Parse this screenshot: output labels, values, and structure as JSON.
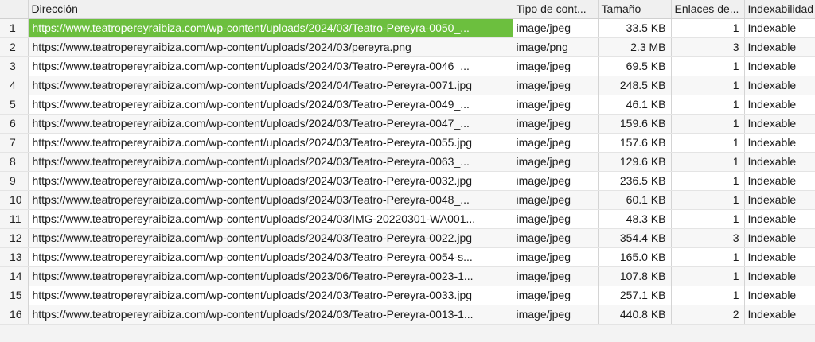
{
  "table": {
    "columns": [
      "",
      "Dirección",
      "Tipo de cont...",
      "Tamaño",
      "Enlaces de...",
      "Indexabilidad"
    ],
    "rows": [
      {
        "n": "1",
        "address": "https://www.teatropereyraibiza.com/wp-content/uploads/2024/03/Teatro-Pereyra-0050_...",
        "type": "image/jpeg",
        "size": "33.5 KB",
        "links": "1",
        "index": "Indexable"
      },
      {
        "n": "2",
        "address": "https://www.teatropereyraibiza.com/wp-content/uploads/2024/03/pereyra.png",
        "type": "image/png",
        "size": "2.3 MB",
        "links": "3",
        "index": "Indexable"
      },
      {
        "n": "3",
        "address": "https://www.teatropereyraibiza.com/wp-content/uploads/2024/03/Teatro-Pereyra-0046_...",
        "type": "image/jpeg",
        "size": "69.5 KB",
        "links": "1",
        "index": "Indexable"
      },
      {
        "n": "4",
        "address": "https://www.teatropereyraibiza.com/wp-content/uploads/2024/04/Teatro-Pereyra-0071.jpg",
        "type": "image/jpeg",
        "size": "248.5 KB",
        "links": "1",
        "index": "Indexable"
      },
      {
        "n": "5",
        "address": "https://www.teatropereyraibiza.com/wp-content/uploads/2024/03/Teatro-Pereyra-0049_...",
        "type": "image/jpeg",
        "size": "46.1 KB",
        "links": "1",
        "index": "Indexable"
      },
      {
        "n": "6",
        "address": "https://www.teatropereyraibiza.com/wp-content/uploads/2024/03/Teatro-Pereyra-0047_...",
        "type": "image/jpeg",
        "size": "159.6 KB",
        "links": "1",
        "index": "Indexable"
      },
      {
        "n": "7",
        "address": "https://www.teatropereyraibiza.com/wp-content/uploads/2024/03/Teatro-Pereyra-0055.jpg",
        "type": "image/jpeg",
        "size": "157.6 KB",
        "links": "1",
        "index": "Indexable"
      },
      {
        "n": "8",
        "address": "https://www.teatropereyraibiza.com/wp-content/uploads/2024/03/Teatro-Pereyra-0063_...",
        "type": "image/jpeg",
        "size": "129.6 KB",
        "links": "1",
        "index": "Indexable"
      },
      {
        "n": "9",
        "address": "https://www.teatropereyraibiza.com/wp-content/uploads/2024/03/Teatro-Pereyra-0032.jpg",
        "type": "image/jpeg",
        "size": "236.5 KB",
        "links": "1",
        "index": "Indexable"
      },
      {
        "n": "10",
        "address": "https://www.teatropereyraibiza.com/wp-content/uploads/2024/03/Teatro-Pereyra-0048_...",
        "type": "image/jpeg",
        "size": "60.1 KB",
        "links": "1",
        "index": "Indexable"
      },
      {
        "n": "11",
        "address": "https://www.teatropereyraibiza.com/wp-content/uploads/2024/03/IMG-20220301-WA001...",
        "type": "image/jpeg",
        "size": "48.3 KB",
        "links": "1",
        "index": "Indexable"
      },
      {
        "n": "12",
        "address": "https://www.teatropereyraibiza.com/wp-content/uploads/2024/03/Teatro-Pereyra-0022.jpg",
        "type": "image/jpeg",
        "size": "354.4 KB",
        "links": "3",
        "index": "Indexable"
      },
      {
        "n": "13",
        "address": "https://www.teatropereyraibiza.com/wp-content/uploads/2024/03/Teatro-Pereyra-0054-s...",
        "type": "image/jpeg",
        "size": "165.0 KB",
        "links": "1",
        "index": "Indexable"
      },
      {
        "n": "14",
        "address": "https://www.teatropereyraibiza.com/wp-content/uploads/2023/06/Teatro-Pereyra-0023-1...",
        "type": "image/jpeg",
        "size": "107.8 KB",
        "links": "1",
        "index": "Indexable"
      },
      {
        "n": "15",
        "address": "https://www.teatropereyraibiza.com/wp-content/uploads/2024/03/Teatro-Pereyra-0033.jpg",
        "type": "image/jpeg",
        "size": "257.1 KB",
        "links": "1",
        "index": "Indexable"
      },
      {
        "n": "16",
        "address": "https://www.teatropereyraibiza.com/wp-content/uploads/2024/03/Teatro-Pereyra-0013-1...",
        "type": "image/jpeg",
        "size": "440.8 KB",
        "links": "2",
        "index": "Indexable"
      }
    ],
    "selected_row": 0
  },
  "colors": {
    "selection": "#6cbf3e",
    "header_bg": "#f0f0f0",
    "row_alt_bg": "#f7f7f7"
  }
}
